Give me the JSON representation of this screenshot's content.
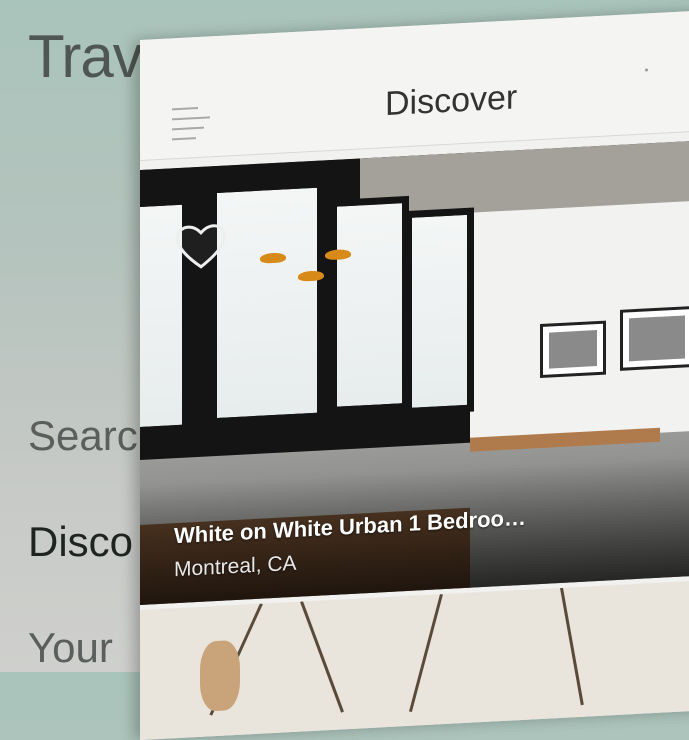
{
  "side_menu": {
    "title": "Trav",
    "items": [
      {
        "label": "Searc"
      },
      {
        "label": "Disco"
      },
      {
        "label": "Your"
      }
    ]
  },
  "navbar": {
    "title": "Discover",
    "menu_icon": "hamburger-menu-icon"
  },
  "listings": [
    {
      "title": "White on White Urban 1 Bedroo…",
      "location": "Montreal, CA",
      "favorite_icon": "heart-outline-icon"
    }
  ],
  "colors": {
    "panel_bg": "#f1f1ef",
    "side_bg": "#b4c3bd",
    "listing_text": "#ffffff"
  }
}
